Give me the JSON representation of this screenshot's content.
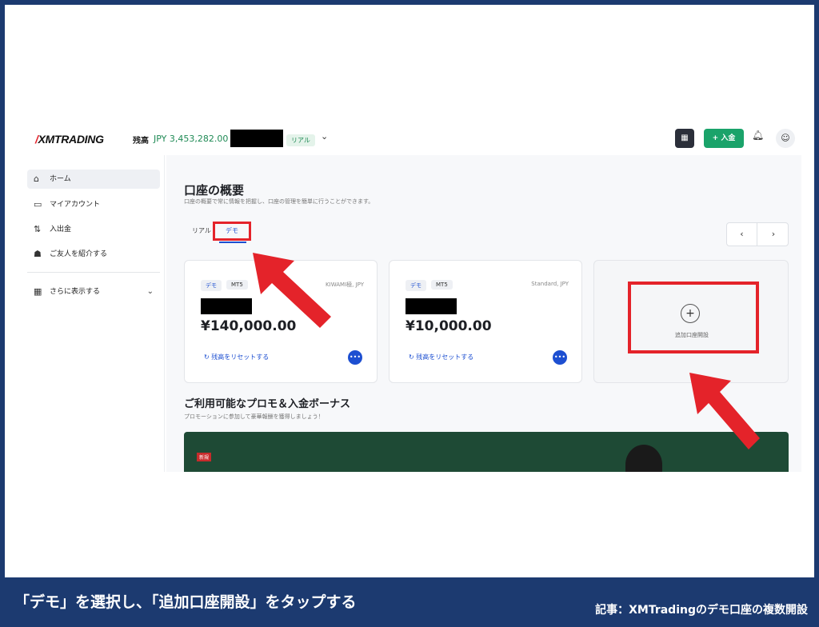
{
  "header": {
    "logo": "XMTRADING",
    "balance_label": "残高",
    "balance_value": "JPY 3,453,282.00",
    "account_badge": "リアル",
    "qr_icon": "qr-code-icon",
    "deposit_label": "+ 入金",
    "bell_icon": "bell-icon",
    "user_icon": "user-icon"
  },
  "sidebar": {
    "items": [
      {
        "label": "ホーム",
        "icon": "home-icon",
        "active": true
      },
      {
        "label": "マイアカウント",
        "icon": "card-icon",
        "active": false
      },
      {
        "label": "入出金",
        "icon": "transfer-icon",
        "active": false
      },
      {
        "label": "ご友人を紹介する",
        "icon": "people-icon",
        "active": false
      }
    ],
    "more_label": "さらに表示する"
  },
  "main": {
    "title": "口座の概要",
    "subtitle": "口座の概要で常に情報を把握し、口座の管理を簡単に行うことができます。",
    "tabs": [
      {
        "label": "リアル",
        "active": false
      },
      {
        "label": "デモ",
        "active": true
      }
    ],
    "pager": {
      "prev": "‹",
      "next": "›"
    },
    "accounts": [
      {
        "chips": [
          "デモ",
          "MT5"
        ],
        "type": "KIWAMI極, JPY",
        "balance": "¥140,000.00",
        "reset_label": "残高をリセットする",
        "more": "•••"
      },
      {
        "chips": [
          "デモ",
          "MT5"
        ],
        "type": "Standard, JPY",
        "balance": "¥10,000.00",
        "reset_label": "残高をリセットする",
        "more": "•••"
      }
    ],
    "add_account": {
      "plus": "+",
      "label": "追加口座開設"
    },
    "promo": {
      "title": "ご利用可能なプロモ＆入金ボーナス",
      "subtitle": "プロモーションに参加して豪華報酬を獲得しましょう！",
      "new_badge": "新規"
    }
  },
  "annotation": {
    "color": "#e4232a",
    "caption": "「デモ」を選択し、「追加口座開設」をタップする",
    "article": "記事：XMTradingのデモ口座の複数開設"
  }
}
